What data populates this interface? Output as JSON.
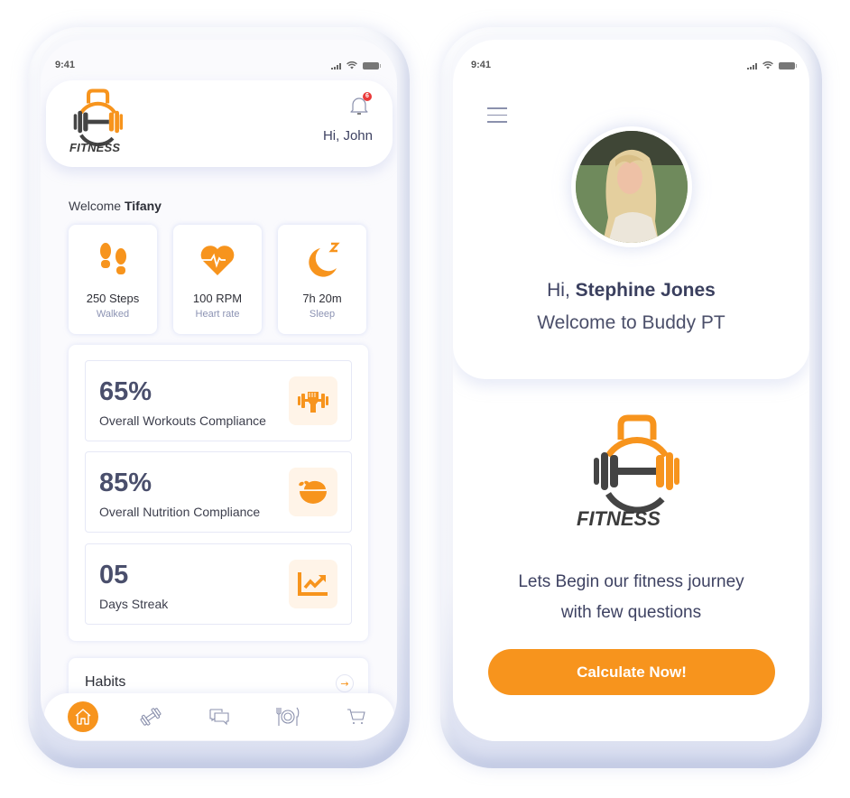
{
  "colors": {
    "accent": "#f7941d",
    "text_dark": "#3e4262",
    "text_muted": "#8c93b3",
    "badge_red": "#ea3a3a",
    "icon_bg": "#fff4e8"
  },
  "left_phone": {
    "status_time": "9:41",
    "header": {
      "logo_text": "FITNESS",
      "notification_count": "6",
      "greeting": "Hi, John"
    },
    "welcome": {
      "prefix": "Welcome",
      "name": "Tifany"
    },
    "stats": [
      {
        "icon": "footprints-icon",
        "value": "250 Steps",
        "label": "Walked"
      },
      {
        "icon": "heart-rate-icon",
        "value": "100 RPM",
        "label": "Heart rate"
      },
      {
        "icon": "moon-sleep-icon",
        "value": "7h 20m",
        "label": "Sleep"
      }
    ],
    "metrics": [
      {
        "icon": "dumbbell-fist-icon",
        "value": "65%",
        "label": "Overall Workouts Compliance"
      },
      {
        "icon": "salad-bowl-icon",
        "value": "85%",
        "label": "Overall Nutrition Compliance"
      },
      {
        "icon": "trending-up-chart-icon",
        "value": "05",
        "label": "Days Streak"
      }
    ],
    "habits": {
      "title": "Habits",
      "arrow_icon": "arrow-right-icon"
    },
    "bottom_nav": [
      {
        "icon": "home-icon",
        "active": true
      },
      {
        "icon": "dumbbell-icon",
        "active": false
      },
      {
        "icon": "chat-icon",
        "active": false
      },
      {
        "icon": "plate-cutlery-icon",
        "active": false
      },
      {
        "icon": "cart-icon",
        "active": false
      }
    ]
  },
  "right_phone": {
    "status_time": "9:41",
    "menu_icon": "hamburger-menu-icon",
    "greeting_prefix": "Hi,",
    "user_name": "Stephine Jones",
    "welcome_text": "Welcome to Buddy PT",
    "logo_text": "FITNESS",
    "journey_line1": "Lets Begin our fitness journey",
    "journey_line2": "with few questions",
    "cta_label": "Calculate Now!"
  }
}
